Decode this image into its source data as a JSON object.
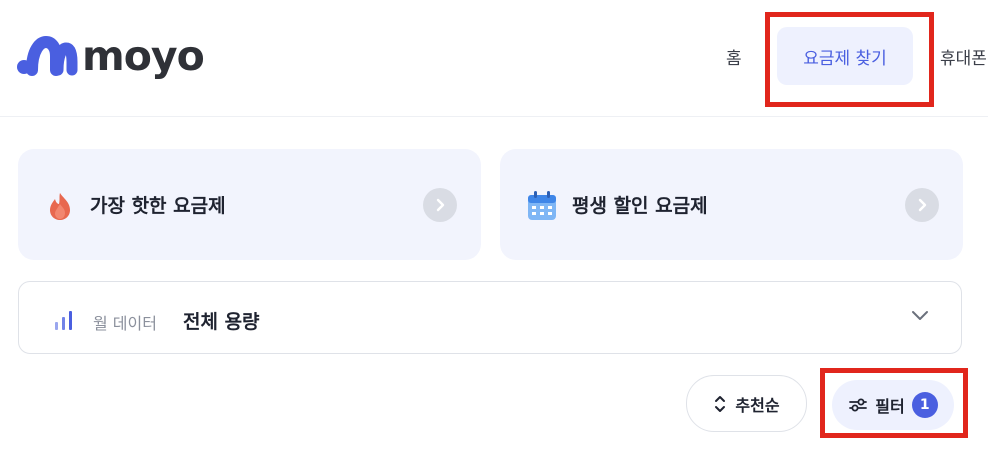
{
  "header": {
    "logo_text": "moyo",
    "nav": {
      "home": "홈",
      "find_plans": "요금제 찾기",
      "phones": "휴대폰"
    }
  },
  "cards": [
    {
      "label": "가장 핫한 요금제",
      "icon": "flame-icon"
    },
    {
      "label": "평생 할인 요금제",
      "icon": "calendar-icon"
    }
  ],
  "data_filter": {
    "label": "월 데이터",
    "value": "전체 용량",
    "icon": "bar-chart-icon"
  },
  "sort": {
    "label": "추천순",
    "icon": "sort-icon"
  },
  "filter": {
    "label": "필터",
    "badge": "1",
    "icon": "sliders-icon"
  },
  "colors": {
    "accent": "#4a5fe0",
    "accent_light": "#eef1fe",
    "card_bg": "#f2f4fd",
    "highlight": "#e1261c",
    "text_primary": "#1f2330",
    "text_muted": "#8b909c"
  }
}
